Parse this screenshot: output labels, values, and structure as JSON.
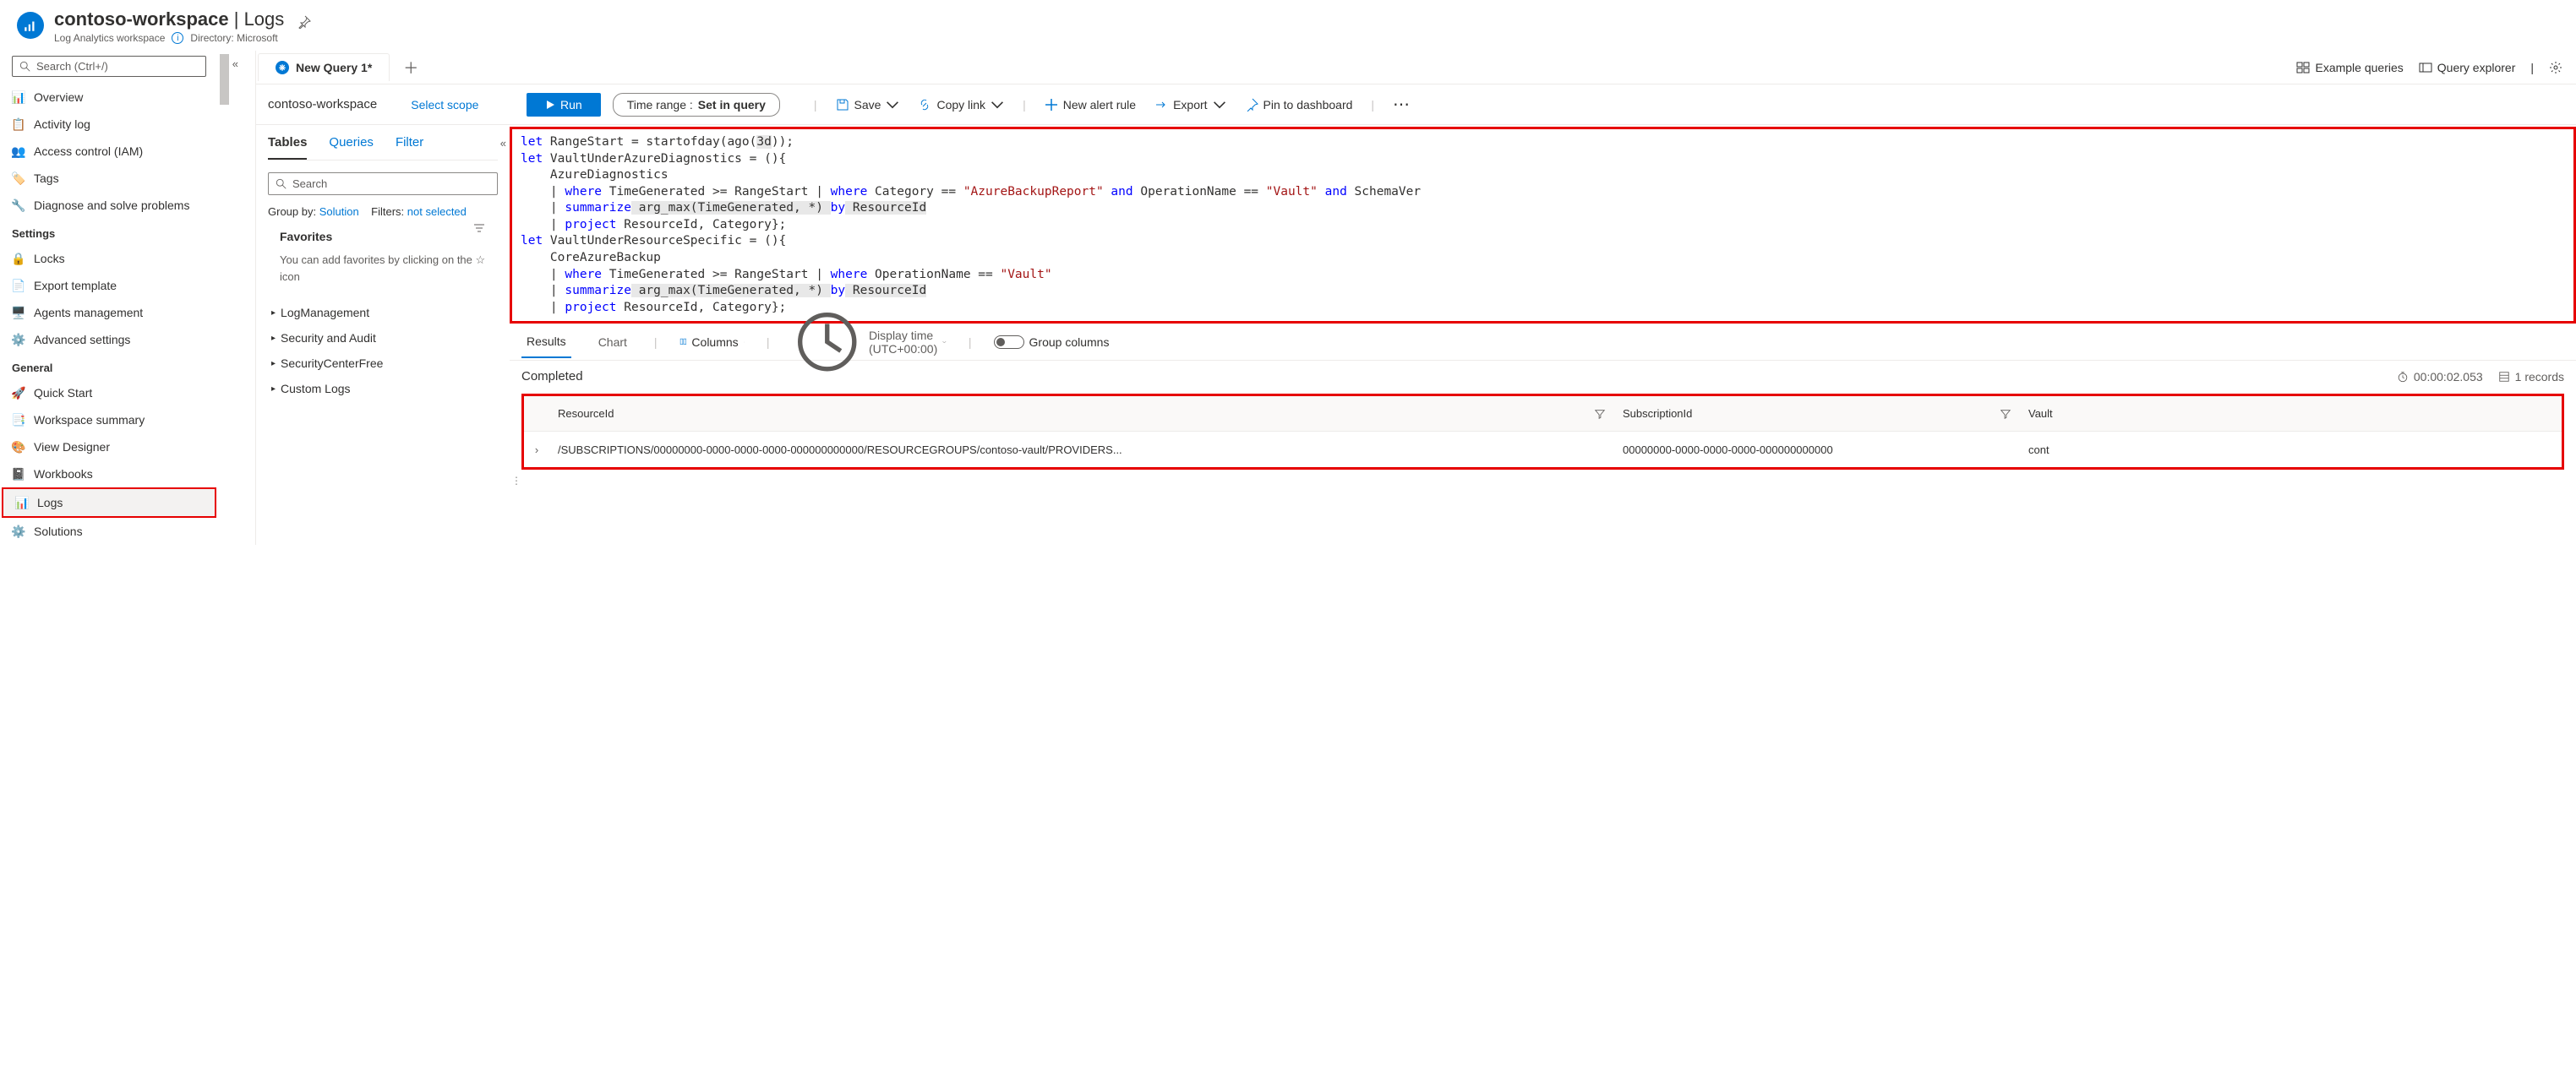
{
  "header": {
    "title_left": "contoso-workspace",
    "title_right": "Logs",
    "subtitle": "Log Analytics workspace",
    "directory_label": "Directory: Microsoft"
  },
  "sidebar": {
    "search_placeholder": "Search (Ctrl+/)",
    "items_top": [
      {
        "label": "Overview"
      },
      {
        "label": "Activity log"
      },
      {
        "label": "Access control (IAM)"
      },
      {
        "label": "Tags"
      },
      {
        "label": "Diagnose and solve problems"
      }
    ],
    "section_settings": "Settings",
    "items_settings": [
      {
        "label": "Locks"
      },
      {
        "label": "Export template"
      },
      {
        "label": "Agents management"
      },
      {
        "label": "Advanced settings"
      }
    ],
    "section_general": "General",
    "items_general": [
      {
        "label": "Quick Start"
      },
      {
        "label": "Workspace summary"
      },
      {
        "label": "View Designer"
      },
      {
        "label": "Workbooks"
      },
      {
        "label": "Logs"
      },
      {
        "label": "Solutions"
      }
    ]
  },
  "tabs": {
    "query_tab": "New Query 1*"
  },
  "topright": {
    "example": "Example queries",
    "explorer": "Query explorer"
  },
  "scopebar": {
    "workspace": "contoso-workspace",
    "select_scope": "Select scope",
    "run": "Run",
    "time_range_label": "Time range :",
    "time_range_value": "Set in query"
  },
  "toolbar": {
    "save": "Save",
    "copy": "Copy link",
    "alert": "New alert rule",
    "export": "Export",
    "pin": "Pin to dashboard"
  },
  "tables_panel": {
    "tab_tables": "Tables",
    "tab_queries": "Queries",
    "tab_filter": "Filter",
    "search_placeholder": "Search",
    "group_by_label": "Group by:",
    "group_by_value": "Solution",
    "filters_label": "Filters:",
    "filters_value": "not selected",
    "favorites_title": "Favorites",
    "favorites_text": "You can add favorites by clicking on the ☆ icon",
    "tree": [
      "LogManagement",
      "Security and Audit",
      "SecurityCenterFree",
      "Custom Logs"
    ]
  },
  "query": {
    "l1a": "let",
    "l1b": " RangeStart = startofday(ago(",
    "l1c": "3d",
    "l1d": "));",
    "l2a": "let",
    "l2b": " VaultUnderAzureDiagnostics = (){",
    "l3": "    AzureDiagnostics",
    "l4a": "    | ",
    "l4b": "where",
    "l4c": " TimeGenerated >= RangeStart | ",
    "l4d": "where",
    "l4e": " Category == ",
    "l4f": "\"AzureBackupReport\"",
    "l4g": " and",
    "l4h": " OperationName == ",
    "l4i": "\"Vault\"",
    "l4j": " and",
    "l4k": " SchemaVer",
    "l5a": "    | ",
    "l5b": "summarize",
    "l5c": " arg_max(TimeGenerated, *) ",
    "l5d": "by",
    "l5e": " ResourceId",
    "l6a": "    | ",
    "l6b": "project",
    "l6c": " ResourceId, Category};",
    "l7a": "let",
    "l7b": " VaultUnderResourceSpecific = (){",
    "l8": "    CoreAzureBackup",
    "l9a": "    | ",
    "l9b": "where",
    "l9c": " TimeGenerated >= RangeStart | ",
    "l9d": "where",
    "l9e": " OperationName ==",
    "l9f": " \"Vault\"",
    "l10a": "    | ",
    "l10b": "summarize",
    "l10c": " arg_max(TimeGenerated, *) ",
    "l10d": "by",
    "l10e": " ResourceId",
    "l11a": "    | ",
    "l11b": "project",
    "l11c": " ResourceId, Category};"
  },
  "results_toolbar": {
    "results": "Results",
    "chart": "Chart",
    "columns": "Columns",
    "display_time": "Display time (UTC+00:00)",
    "group_columns": "Group columns"
  },
  "status": {
    "completed": "Completed",
    "duration": "00:00:02.053",
    "records": "1 records"
  },
  "grid": {
    "cols": {
      "resource": "ResourceId",
      "subscription": "SubscriptionId",
      "vault": "Vault"
    },
    "row": {
      "resource": "/SUBSCRIPTIONS/00000000-0000-0000-0000-000000000000/RESOURCEGROUPS/contoso-vault/PROVIDERS...",
      "subscription": "00000000-0000-0000-0000-000000000000",
      "vault": "cont"
    }
  }
}
